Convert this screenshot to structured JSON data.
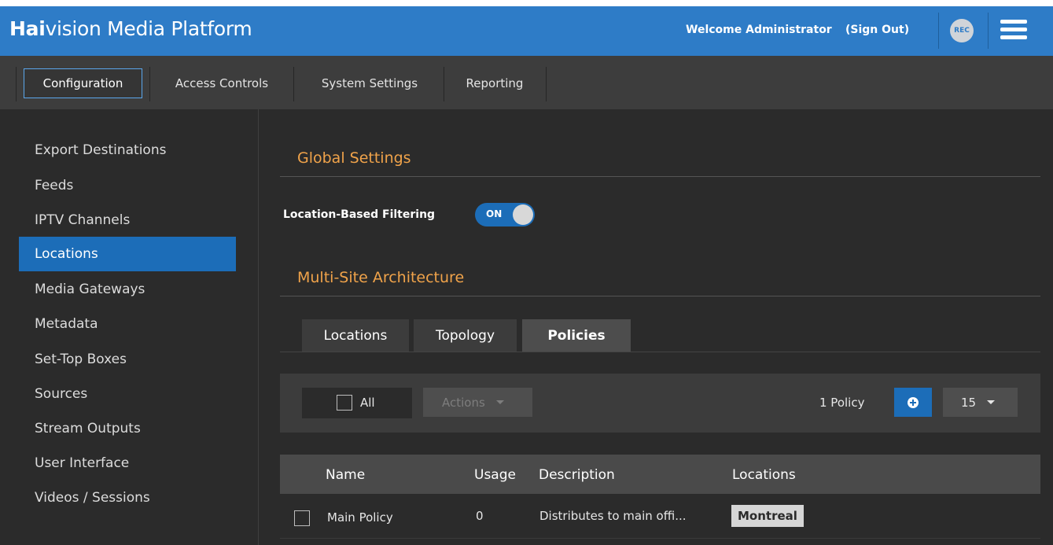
{
  "header": {
    "brand_bold": "Hai",
    "brand_rest": "vision Media Platform",
    "welcome": "Welcome Administrator",
    "sign_out": "(Sign Out)",
    "rec_label": "REC",
    "accent": "#2e7cc7"
  },
  "nav": {
    "tabs": [
      "Configuration",
      "Access Controls",
      "System Settings",
      "Reporting"
    ],
    "active": "Configuration"
  },
  "sidebar": {
    "items": [
      "Export Destinations",
      "Feeds",
      "IPTV Channels",
      "Locations",
      "Media Gateways",
      "Metadata",
      "Set-Top Boxes",
      "Sources",
      "Stream Outputs",
      "User Interface",
      "Videos / Sessions"
    ],
    "active": "Locations"
  },
  "global_settings": {
    "title": "Global Settings",
    "location_filter_label": "Location-Based Filtering",
    "toggle_text": "ON"
  },
  "multi_site": {
    "title": "Multi-Site Architecture",
    "tabs": [
      "Locations",
      "Topology",
      "Policies"
    ],
    "active_tab": "Policies"
  },
  "toolbar": {
    "all_label": "All",
    "actions_label": "Actions",
    "count": "1 Policy",
    "page_size": "15"
  },
  "table": {
    "headers": [
      "Name",
      "Usage",
      "Description",
      "Locations"
    ],
    "rows": [
      {
        "name": "Main Policy",
        "usage": "0",
        "description": "Distributes to main offi...",
        "location": "Montreal"
      }
    ]
  }
}
